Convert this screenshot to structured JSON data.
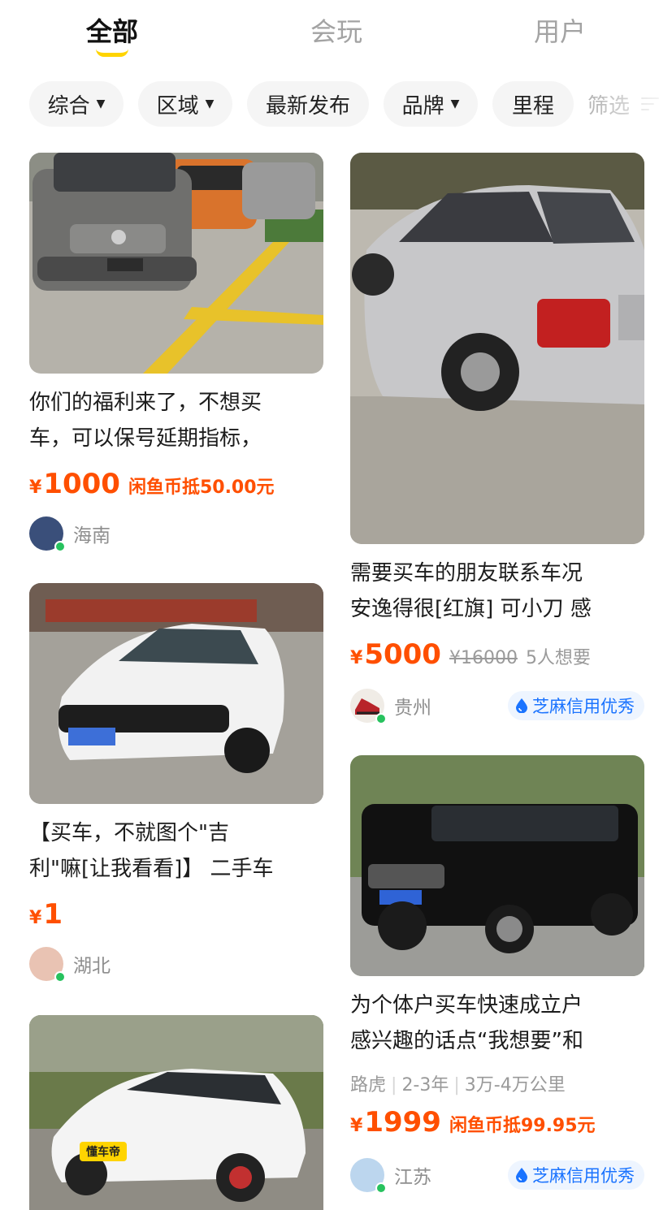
{
  "tabs": [
    {
      "label": "全部",
      "active": true
    },
    {
      "label": "会玩",
      "active": false
    },
    {
      "label": "用户",
      "active": false
    }
  ],
  "filters": [
    {
      "label": "综合",
      "has_caret": true
    },
    {
      "label": "区域",
      "has_caret": true
    },
    {
      "label": "最新发布",
      "has_caret": false
    },
    {
      "label": "品牌",
      "has_caret": true
    },
    {
      "label": "里程",
      "has_caret": false
    },
    {
      "label": "筛选",
      "icon": "filter-icon"
    }
  ],
  "cards": [
    {
      "title_lines": [
        "你们的福利来了，不想买",
        "车，可以保号延期指标，"
      ],
      "currency": "¥",
      "price": "1000",
      "coin_offset": "闲鱼币抵50.00元",
      "region": "海南"
    },
    {
      "title_lines": [
        "需要买车的朋友联系车况",
        "安逸得很[红旗] 可小刀 感"
      ],
      "currency": "¥",
      "price": "5000",
      "original_price": "¥16000",
      "wants": "5人想要",
      "region": "贵州",
      "badge": "芝麻信用优秀"
    },
    {
      "title_lines": [
        "【买车，不就图个\"吉",
        "利\"嘛[让我看看]】 二手车"
      ],
      "currency": "¥",
      "price": "1",
      "region": "湖北"
    },
    {
      "title_lines": [
        "为个体户买车快速成立户",
        "感兴趣的话点“我想要”和"
      ],
      "tags": [
        "路虎",
        "2-3年",
        "3万-4万公里"
      ],
      "currency": "¥",
      "price": "1999",
      "coin_offset": "闲鱼币抵99.95元",
      "region": "江苏",
      "badge": "芝麻信用优秀"
    },
    {
      "photo_sticker": "懂车帝"
    }
  ],
  "colors": {
    "accent_yellow": "#ffd400",
    "price_orange": "#ff4f00",
    "credit_blue": "#1a73ff",
    "online_green": "#27c25e"
  }
}
